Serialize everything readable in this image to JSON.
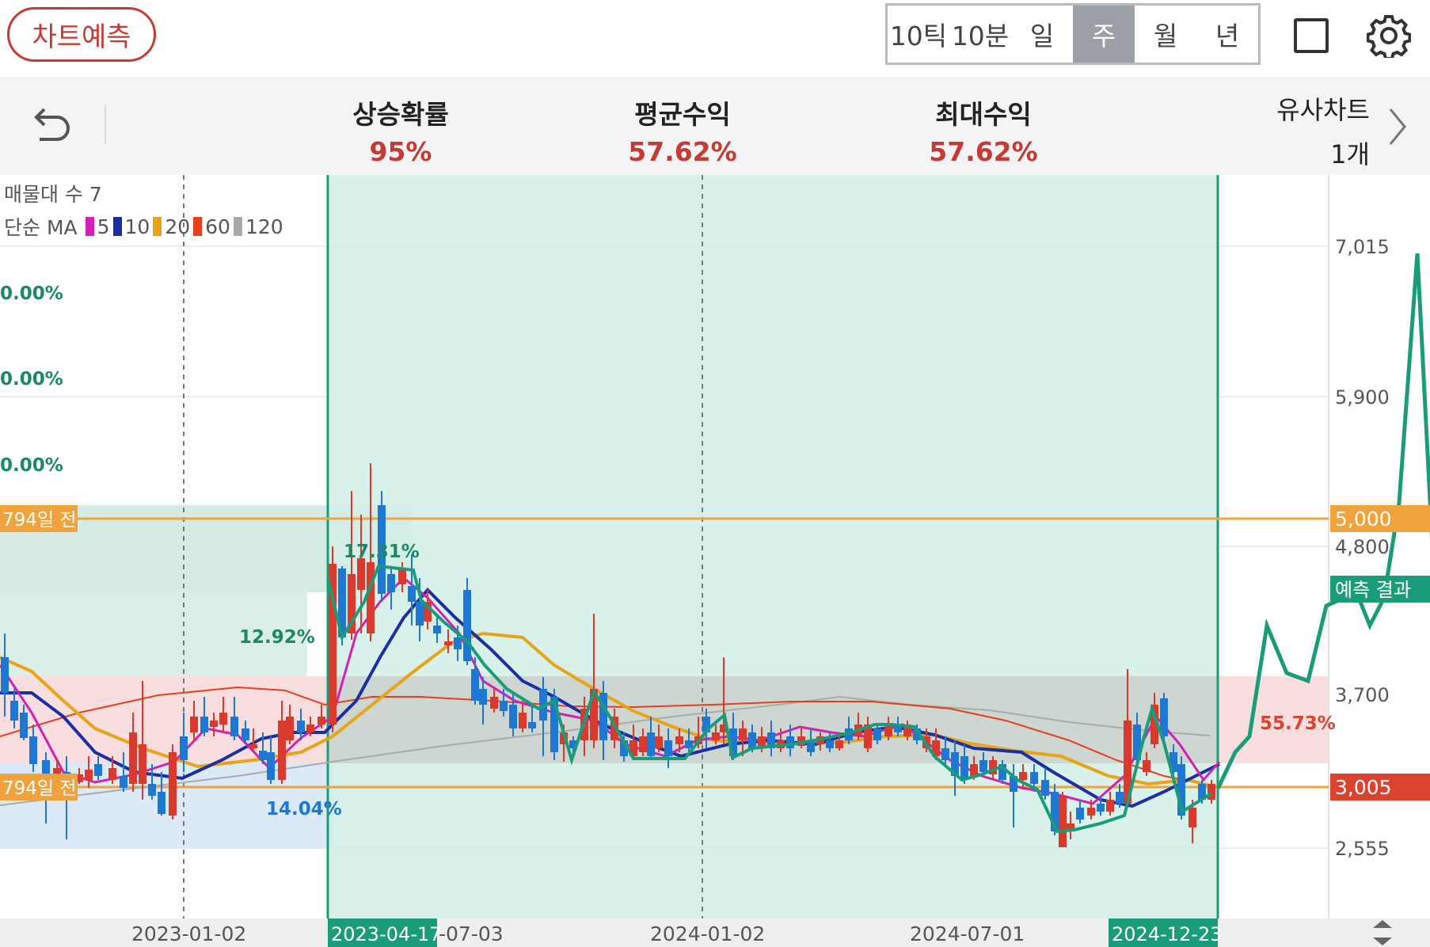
{
  "header": {
    "predict_button": "차트예측",
    "period_tabs": [
      "10틱",
      "10분",
      "일",
      "주",
      "월",
      "년"
    ],
    "active_tab": "주"
  },
  "stats": {
    "rise_prob_label": "상승확률",
    "rise_prob_value": "95%",
    "avg_return_label": "평균수익",
    "avg_return_value": "57.62%",
    "max_return_label": "최대수익",
    "max_return_value": "57.62%",
    "similar_label": "유사차트",
    "similar_value": "1개"
  },
  "chart_panel": {
    "volume_profile_label": "매물대 수 7",
    "ma_label": "단순 MA",
    "ma_periods": [
      {
        "period": "5",
        "color": "#d21fb4"
      },
      {
        "period": "10",
        "color": "#1b2fa3"
      },
      {
        "period": "20",
        "color": "#e8a318"
      },
      {
        "period": "60",
        "color": "#e5401e"
      },
      {
        "period": "120",
        "color": "#a9a9a9"
      }
    ],
    "left_pcts": [
      "0.00%",
      "0.00%",
      "0.00%"
    ],
    "zone_pct_top": "17.31%",
    "zone_pct_green": "12.92%",
    "zone_pct_blue": "14.04%",
    "zone_pct_red": "55.73%",
    "days_ago_upper": "794일 전",
    "days_ago_lower": "794일 전",
    "y_ticks": [
      "7,015",
      "5,900",
      "4,800",
      "3,700",
      "2,555"
    ],
    "price_tag_upper": "5,000",
    "price_tag_lower": "3,005",
    "prediction_tag": "예측 결과",
    "x_ticks": [
      "2023-01-02",
      "-07-03",
      "2024-01-02",
      "2024-07-01"
    ],
    "x_highlight_start": "2023-04-17",
    "x_highlight_end": "2024-12-23",
    "colors": {
      "up": "#d93a2e",
      "down": "#1e78d2",
      "pattern": "#1a9c78",
      "orange_line": "#f0a23c",
      "red_tag": "#d9432f"
    }
  },
  "chart_data": {
    "type": "candlestick",
    "y_axis_ticks": [
      2555,
      3700,
      4800,
      5900,
      7015
    ],
    "reference_levels": [
      5000,
      3005
    ],
    "prediction_path": [
      3005,
      3450,
      4350,
      3750,
      3700,
      4300,
      4350,
      4200,
      7015
    ]
  }
}
